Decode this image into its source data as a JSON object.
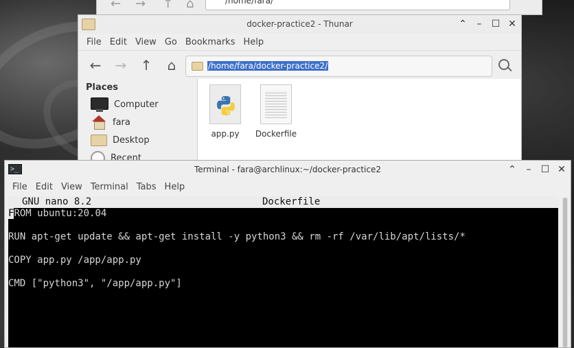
{
  "background_window": {
    "path": "/home/fara/"
  },
  "thunar": {
    "title": "docker-practice2 - Thunar",
    "menu": [
      "File",
      "Edit",
      "View",
      "Go",
      "Bookmarks",
      "Help"
    ],
    "location": "/home/fara/docker-practice2/",
    "sidebar": {
      "heading": "Places",
      "items": [
        {
          "label": "Computer",
          "icon": "computer-icon"
        },
        {
          "label": "fara",
          "icon": "home-icon"
        },
        {
          "label": "Desktop",
          "icon": "folder-icon"
        },
        {
          "label": "Recent",
          "icon": "recent-icon"
        }
      ]
    },
    "files": [
      {
        "name": "app.py",
        "icon": "python-file-icon"
      },
      {
        "name": "Dockerfile",
        "icon": "text-file-icon"
      }
    ]
  },
  "terminal": {
    "title": "Terminal - fara@archlinux:~/docker-practice2",
    "menu": [
      "File",
      "Edit",
      "View",
      "Terminal",
      "Tabs",
      "Help"
    ],
    "nano": {
      "version": "GNU nano 8.2",
      "filename": "Dockerfile",
      "cursor_char": "F",
      "lines": [
        "ROM ubuntu:20.04",
        "",
        "RUN apt-get update && apt-get install -y python3 && rm -rf /var/lib/apt/lists/*",
        "",
        "COPY app.py /app/app.py",
        "",
        "CMD [\"python3\", \"/app/app.py\"]"
      ]
    }
  },
  "colors": {
    "selection": "#3d6fc9",
    "terminal_bg": "#000000",
    "terminal_fg": "#d6d6d6"
  }
}
